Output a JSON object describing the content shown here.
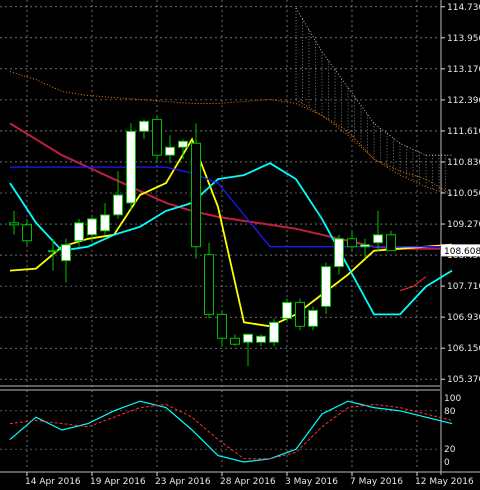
{
  "chart_data": [
    {
      "type": "candlestick",
      "title": "",
      "instrument_price_label": "108.608",
      "price_axis_ticks": [
        "114.730",
        "113.950",
        "113.170",
        "112.390",
        "111.610",
        "110.830",
        "110.050",
        "109.270",
        "108.490",
        "107.710",
        "106.930",
        "106.150",
        "105.370"
      ],
      "price_axis_tick_values": [
        114.73,
        113.95,
        113.17,
        112.39,
        111.61,
        110.83,
        110.05,
        109.27,
        108.49,
        107.71,
        106.93,
        106.15,
        105.37
      ],
      "ylim": [
        105.2,
        114.9
      ],
      "date_labels": [
        "14 Apr 2016",
        "19 Apr 2016",
        "23 Apr 2016",
        "28 Apr 2016",
        "3 May 2016",
        "7 May 2016",
        "12 May 2016"
      ],
      "date_label_bar_index": [
        1,
        6,
        11,
        16,
        21,
        26,
        31
      ],
      "candles": [
        {
          "o": 109.3,
          "h": 109.6,
          "l": 109.0,
          "c": 109.25
        },
        {
          "o": 109.25,
          "h": 109.4,
          "l": 108.75,
          "c": 108.85
        },
        {
          "o": 108.6,
          "h": 108.9,
          "l": 108.1,
          "c": 108.6
        },
        {
          "o": 108.35,
          "h": 108.9,
          "l": 107.8,
          "c": 108.75
        },
        {
          "o": 108.85,
          "h": 109.4,
          "l": 108.7,
          "c": 109.3
        },
        {
          "o": 109.0,
          "h": 109.5,
          "l": 108.8,
          "c": 109.4
        },
        {
          "o": 109.1,
          "h": 109.8,
          "l": 109.0,
          "c": 109.5
        },
        {
          "o": 109.5,
          "h": 110.6,
          "l": 109.4,
          "c": 110.0
        },
        {
          "o": 109.8,
          "h": 111.8,
          "l": 109.6,
          "c": 111.6
        },
        {
          "o": 111.6,
          "h": 111.9,
          "l": 111.4,
          "c": 111.85
        },
        {
          "o": 111.9,
          "h": 112.0,
          "l": 110.8,
          "c": 111.0
        },
        {
          "o": 111.0,
          "h": 111.5,
          "l": 110.8,
          "c": 111.2
        },
        {
          "o": 111.2,
          "h": 111.4,
          "l": 110.9,
          "c": 111.35
        },
        {
          "o": 111.3,
          "h": 111.8,
          "l": 108.4,
          "c": 108.7
        },
        {
          "o": 108.5,
          "h": 108.8,
          "l": 106.9,
          "c": 107.0
        },
        {
          "o": 107.0,
          "h": 107.1,
          "l": 106.2,
          "c": 106.4
        },
        {
          "o": 106.4,
          "h": 106.5,
          "l": 106.2,
          "c": 106.25
        },
        {
          "o": 106.3,
          "h": 106.5,
          "l": 105.7,
          "c": 106.5
        },
        {
          "o": 106.3,
          "h": 106.5,
          "l": 106.2,
          "c": 106.45
        },
        {
          "o": 106.3,
          "h": 106.9,
          "l": 106.2,
          "c": 106.8
        },
        {
          "o": 106.9,
          "h": 107.4,
          "l": 106.8,
          "c": 107.3
        },
        {
          "o": 107.3,
          "h": 107.4,
          "l": 106.6,
          "c": 106.7
        },
        {
          "o": 106.7,
          "h": 107.2,
          "l": 106.6,
          "c": 107.1
        },
        {
          "o": 107.2,
          "h": 108.3,
          "l": 107.0,
          "c": 108.2
        },
        {
          "o": 108.2,
          "h": 109.0,
          "l": 108.0,
          "c": 108.9
        },
        {
          "o": 108.9,
          "h": 109.1,
          "l": 108.6,
          "c": 108.7
        },
        {
          "o": 108.7,
          "h": 108.9,
          "l": 108.4,
          "c": 108.75
        },
        {
          "o": 108.8,
          "h": 109.6,
          "l": 108.6,
          "c": 109.0
        },
        {
          "o": 109.0,
          "h": 109.1,
          "l": 108.7,
          "c": 108.6
        }
      ],
      "candle_bar_index": [
        0,
        1,
        3,
        4,
        5,
        6,
        7,
        8,
        9,
        10,
        11,
        12,
        13,
        14,
        15,
        16,
        17,
        18,
        19,
        20,
        21,
        22,
        23,
        24,
        25,
        26,
        27,
        28,
        29
      ],
      "colors": {
        "background": "#000000",
        "bull_candle": "#ffffff",
        "bear_candle": "#000000",
        "candle_outline": "#00c000",
        "tenkan": "#ffff00",
        "kijun": "#00ffff",
        "senkou_a": "#ff3030",
        "senkou_b": "#ff3030",
        "chikou": "#ff8c00",
        "ma": "#c02040",
        "blue_line": "#1a1aff",
        "stoch_main": "#00ffff",
        "stoch_signal": "#ff3030",
        "grid": "#ffffff"
      },
      "series": [
        {
          "values_bar_index": [
            0,
            2,
            4,
            6,
            8,
            10,
            12,
            14,
            16,
            18,
            20,
            22,
            24,
            26,
            28,
            30,
            32,
            34
          ],
          "values": [
            111.8,
            111.4,
            111.0,
            110.7,
            110.4,
            110.1,
            109.8,
            109.6,
            109.45,
            109.35,
            109.25,
            109.15,
            109.0,
            108.85,
            108.7,
            108.65,
            108.65,
            108.65
          ]
        },
        {
          "values_bar_index": [
            0,
            2,
            4,
            6,
            8,
            10,
            12,
            14,
            16,
            18,
            20,
            22,
            24,
            26,
            28,
            30,
            32,
            34
          ],
          "values": [
            108.1,
            108.15,
            108.7,
            108.9,
            109.0,
            110.0,
            110.3,
            111.4,
            109.7,
            106.8,
            106.7,
            107.0,
            107.5,
            108.0,
            108.6,
            108.65,
            108.7,
            108.75
          ]
        },
        {
          "values_bar_index": [
            0,
            2,
            4,
            6,
            8,
            10,
            12,
            14,
            16,
            18,
            20,
            22,
            24,
            26,
            28,
            30,
            32,
            34
          ],
          "values": [
            110.3,
            109.3,
            108.6,
            108.7,
            109.0,
            109.2,
            109.6,
            109.8,
            110.4,
            110.5,
            110.8,
            110.4,
            109.4,
            108.2,
            107.0,
            107.0,
            107.7,
            108.1
          ]
        },
        {
          "values_bar_index": [
            0,
            2,
            4,
            6,
            8,
            10,
            12,
            14,
            16,
            18,
            20,
            22,
            24,
            26,
            28,
            30,
            32,
            34
          ],
          "values": [
            110.7,
            110.7,
            110.7,
            110.7,
            110.7,
            110.7,
            110.7,
            110.55,
            110.3,
            109.5,
            108.7,
            108.7,
            108.7,
            108.7,
            108.7,
            108.7,
            108.7,
            108.7
          ]
        },
        {
          "values_bar_index": [
            0,
            2,
            4,
            6,
            8,
            10,
            12,
            14,
            16,
            18,
            20,
            22,
            24,
            26,
            28,
            30,
            32,
            34
          ],
          "values": [
            113.1,
            112.9,
            112.6,
            112.5,
            112.45,
            112.4,
            112.35,
            112.3,
            112.3,
            112.35,
            112.4,
            112.3,
            112.0,
            111.6,
            110.9,
            110.6,
            110.4,
            110.0
          ]
        },
        {
          "values_bar_index": [
            30,
            31,
            32
          ],
          "values": [
            107.6,
            107.7,
            107.95
          ]
        }
      ],
      "cloud_upper_band": {
        "values_bar_index": [
          22,
          24,
          26,
          28,
          30,
          32,
          34
        ],
        "upper": [
          114.7,
          113.6,
          112.7,
          111.8,
          111.3,
          111.0,
          111.0
        ],
        "lower": [
          112.4,
          112.0,
          111.5,
          110.9,
          110.5,
          110.2,
          110.0
        ]
      },
      "stochastic": {
        "ticks": [
          "100",
          "80",
          "20",
          "0"
        ],
        "tick_values": [
          100,
          80,
          20,
          0
        ],
        "main_bar_index": [
          0,
          2,
          4,
          6,
          8,
          10,
          12,
          14,
          16,
          18,
          20,
          22,
          24,
          26,
          28,
          30,
          32,
          34
        ],
        "main": [
          35,
          70,
          50,
          60,
          80,
          95,
          85,
          50,
          10,
          0,
          5,
          20,
          75,
          95,
          85,
          80,
          70,
          60
        ],
        "signal_bar_index": [
          0,
          2,
          4,
          6,
          8,
          10,
          12,
          14,
          16,
          18,
          20,
          22,
          24,
          26,
          28,
          30,
          32,
          34
        ],
        "signal": [
          60,
          65,
          60,
          55,
          70,
          85,
          90,
          70,
          35,
          5,
          5,
          15,
          55,
          85,
          90,
          85,
          75,
          65
        ]
      }
    }
  ]
}
